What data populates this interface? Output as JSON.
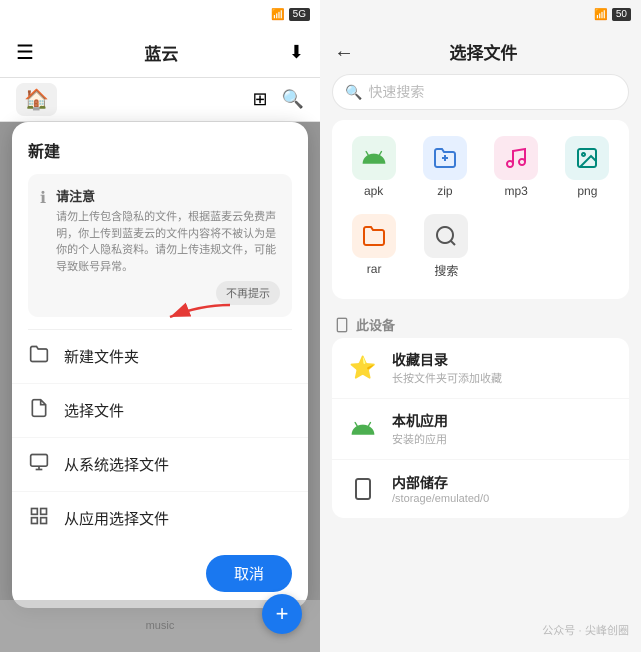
{
  "left": {
    "statusbar": {
      "time": ""
    },
    "header": {
      "menu_icon": "☰",
      "title": "蓝云",
      "download_icon": "⬇",
      "title_label": "蓝云"
    },
    "toolbar": {
      "home_icon": "⌂",
      "grid_icon": "⊞",
      "search_icon": "🔍"
    },
    "modal": {
      "title": "新建",
      "notice": {
        "title": "请注意",
        "text": "请勿上传包含隐私的文件，根据蓝麦云免费声明，你上传到蓝麦云的文件内容将不被认为是你的个人隐私资料。请勿上传违规文件，可能导致账号异常。",
        "no_remind_btn": "不再提示"
      },
      "items": [
        {
          "icon": "📁",
          "label": "新建文件夹"
        },
        {
          "icon": "📄",
          "label": "选择文件"
        },
        {
          "icon": "💾",
          "label": "从系统选择文件"
        },
        {
          "icon": "⊞",
          "label": "从应用选择文件"
        }
      ],
      "cancel_btn": "取消"
    },
    "fab_icon": "+"
  },
  "right": {
    "statusbar": {
      "wifi_icon": "📶",
      "battery": "50"
    },
    "header": {
      "back_icon": "←",
      "title": "选择文件"
    },
    "search": {
      "placeholder": "快速搜索",
      "icon": "🔍"
    },
    "filetypes": [
      {
        "icon": "🤖",
        "label": "apk",
        "color": "green"
      },
      {
        "icon": "🗜",
        "label": "zip",
        "color": "blue"
      },
      {
        "icon": "🎵",
        "label": "mp3",
        "color": "pink"
      },
      {
        "icon": "🖼",
        "label": "png",
        "color": "teal"
      },
      {
        "icon": "📦",
        "label": "rar",
        "color": "orange"
      },
      {
        "icon": "🔍",
        "label": "搜索",
        "color": "gray"
      }
    ],
    "section_title": "此设备",
    "device_icon": "📱",
    "device_items": [
      {
        "icon": "⭐",
        "icon_color": "#f5c518",
        "title": "收藏目录",
        "sub": "长按文件夹可添加收藏"
      },
      {
        "icon": "🤖",
        "title": "本机应用",
        "sub": "安装的应用"
      },
      {
        "icon": "📱",
        "title": "内部储存",
        "sub": "/storage/emulated/0"
      }
    ],
    "watermark": "公众号 · 尖峰创圈"
  }
}
